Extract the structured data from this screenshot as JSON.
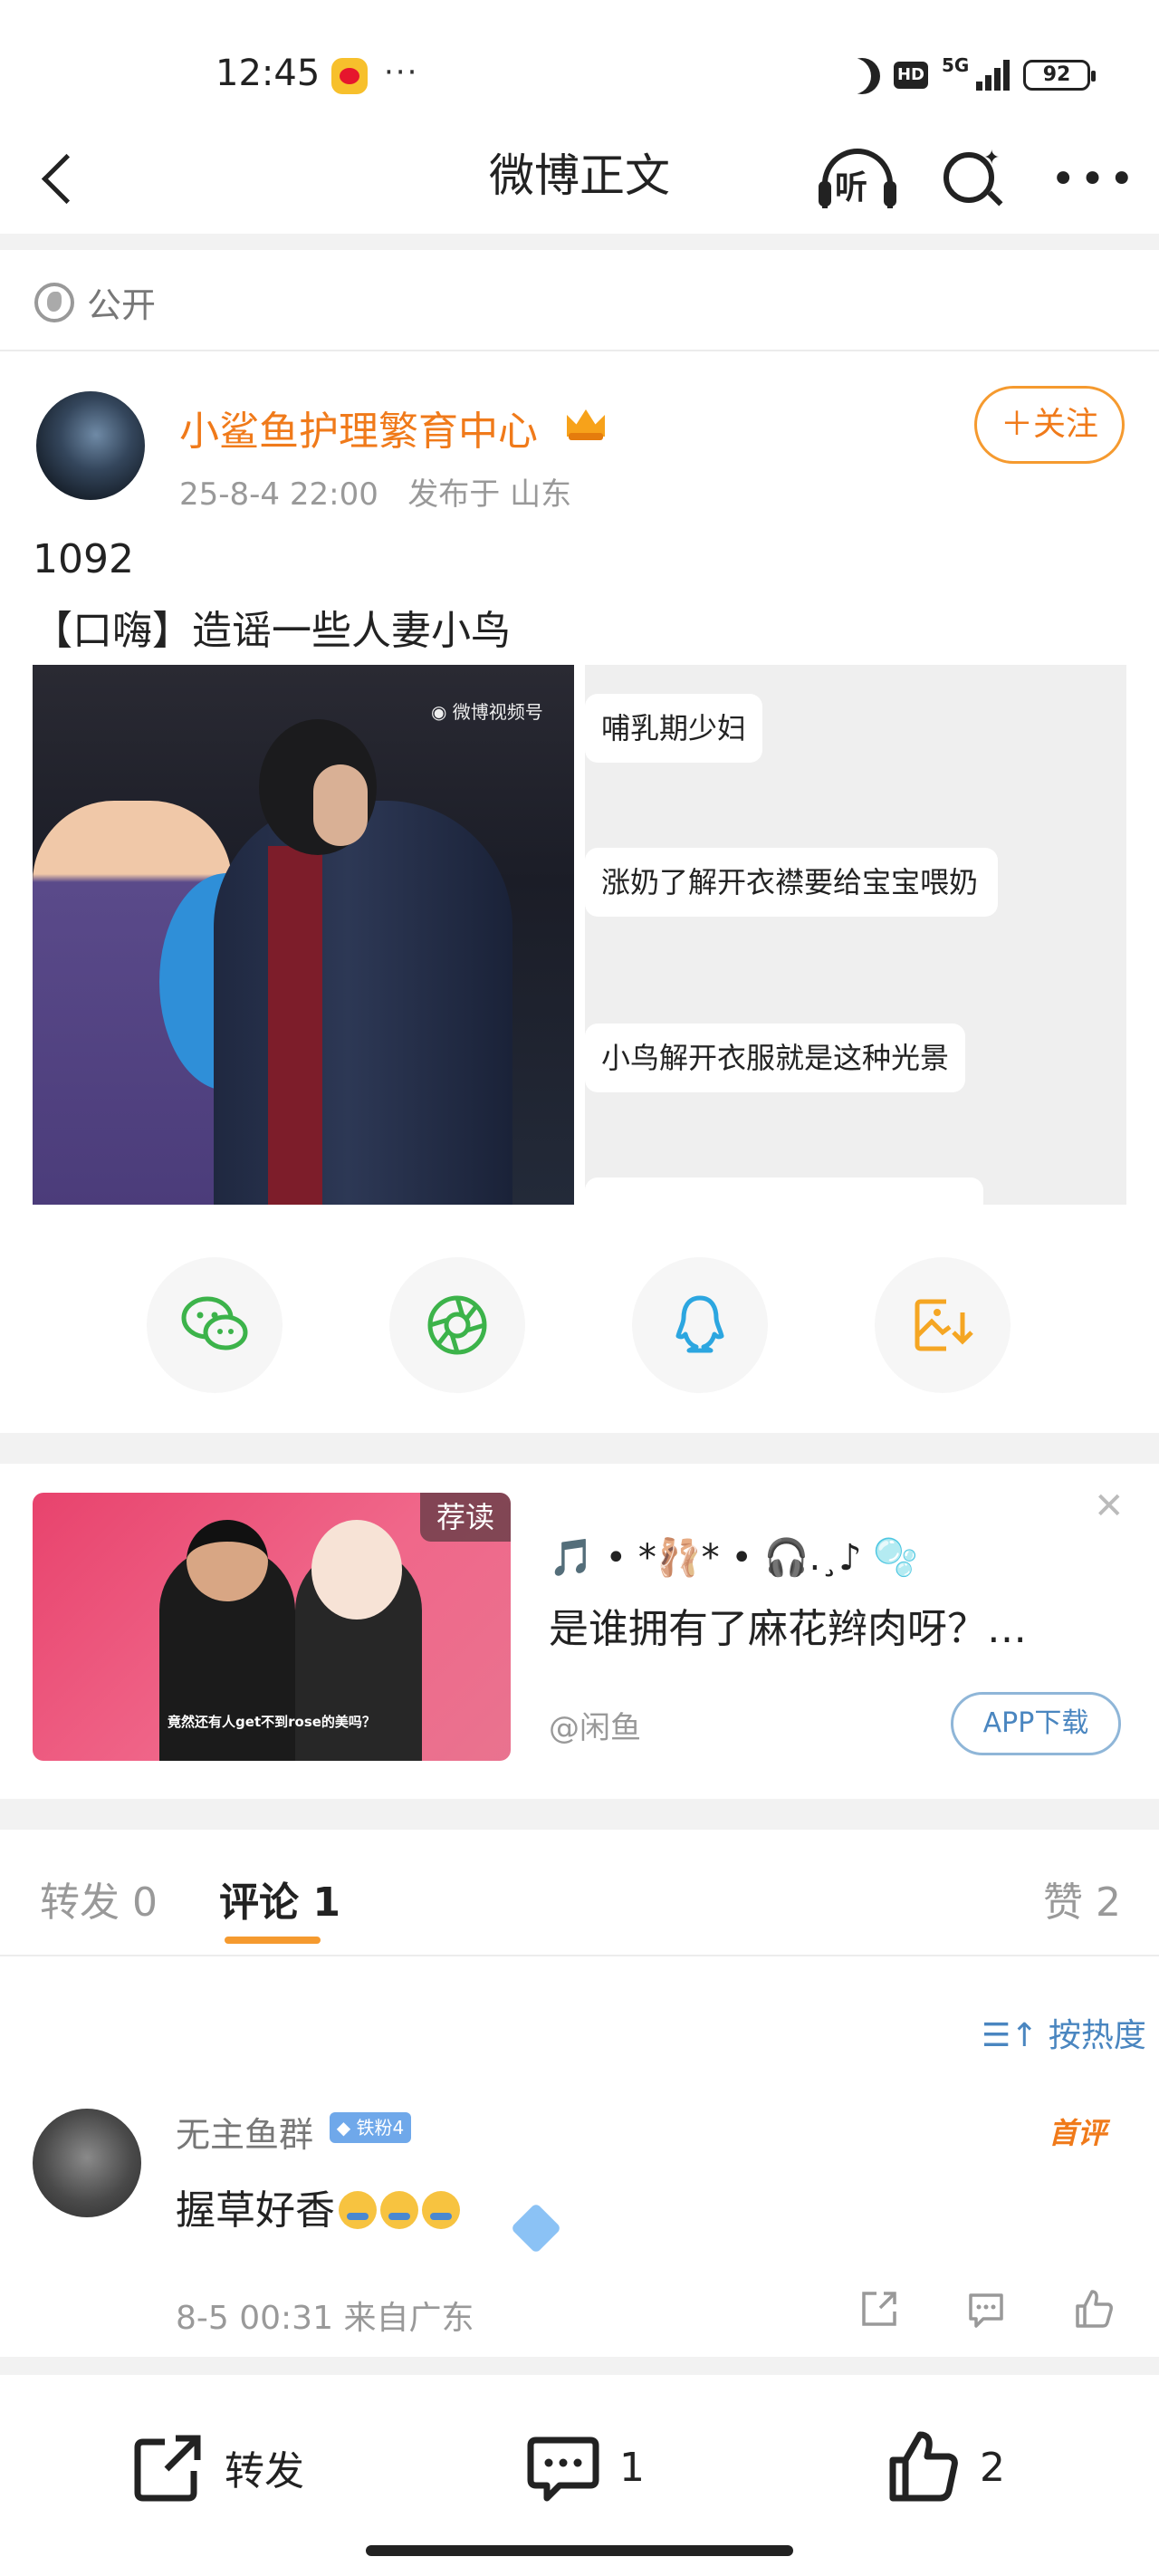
{
  "status": {
    "time": "12:45",
    "battery": "92",
    "network": "5G"
  },
  "header": {
    "title": "微博正文"
  },
  "post": {
    "visibility": "公开",
    "author": "小鲨鱼护理繁育中心",
    "timestamp": "25-8-4 22:00",
    "location": "发布于 山东",
    "follow_label": "＋关注",
    "line1": "1092",
    "line2": "【口嗨】造谣一些人妻小鸟",
    "image_bubbles": [
      "哺乳期少妇",
      "涨奶了解开衣襟要给宝宝喂奶",
      "小鸟解开衣服就是这种光景"
    ]
  },
  "share": {
    "icons": [
      "wechat-icon",
      "moments-icon",
      "qq-icon",
      "save-image-icon"
    ]
  },
  "ad": {
    "tag": "荐读",
    "symbols": "🎵 • *🩰* • 🎧.¸♪ 🫧",
    "title": "是谁拥有了麻花辫肉呀？…",
    "source": "@闲鱼",
    "button": "APP下载",
    "subtitle": "竟然还有人get不到rose的美吗？"
  },
  "tabs": {
    "repost": "转发 0",
    "comment": "评论 1",
    "like": "赞 2"
  },
  "sort_label": "按热度",
  "comment": {
    "name": "无主鱼群",
    "badge": "铁粉4",
    "first_label": "首评",
    "text": "握草好香",
    "date": "8-5 00:31",
    "location": "来自广东"
  },
  "bottom": {
    "repost": "转发",
    "comment": "1",
    "like": "2"
  },
  "colors": {
    "accent": "#f59a2f",
    "link": "#4a86c0",
    "author": "#f07a1a"
  }
}
